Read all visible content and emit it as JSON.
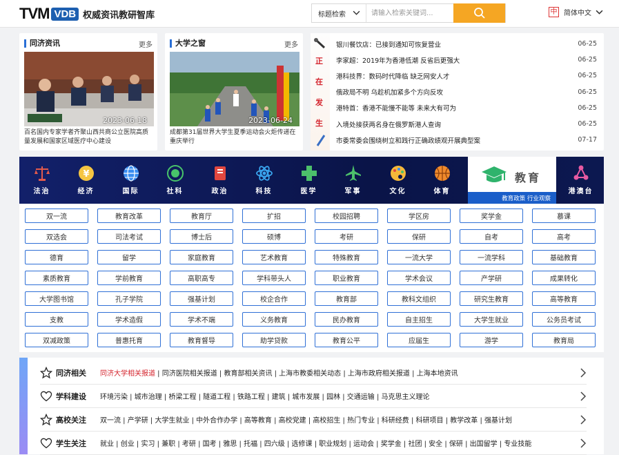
{
  "header": {
    "logo_text": "TVM",
    "logo_badge": "VDB",
    "site_name": "权威资讯教研智库",
    "search_select": "标题检索",
    "search_placeholder": "请输入检索关键词...",
    "lang_icon": "中",
    "lang_label": "简体中文"
  },
  "news_cards": [
    {
      "title": "同济资讯",
      "more": "更多",
      "date": "2023-06-18",
      "caption": "百名国内专家学者齐聚山西共商公立医院高质量发展和国家区域医疗中心建设"
    },
    {
      "title": "大学之窗",
      "more": "更多",
      "date": "2023-06-24",
      "caption": "成都第31届世界大学生夏季运动会火炬传递在重庆举行"
    }
  ],
  "hot": {
    "strip_chars": [
      "正",
      "在",
      "发",
      "生"
    ],
    "items": [
      {
        "text": "银川餐饮店：已接到通知可恢复营业",
        "date": "06-25"
      },
      {
        "text": "李家超：2019年为香港低潮 反省后更强大",
        "date": "06-25"
      },
      {
        "text": "港科技界：数码时代降临 缺乏网安人才",
        "date": "06-25"
      },
      {
        "text": "俄政局不明 乌趁机加紧多个方向反攻",
        "date": "06-25"
      },
      {
        "text": "港特首：香港不能慢不能等 未来大有可为",
        "date": "06-25"
      },
      {
        "text": "入境处接获两名身在俄罗斯港人查询",
        "date": "06-25"
      },
      {
        "text": "市委常委会围绕树立和践行正确政绩观开展典型案",
        "date": "07-17"
      }
    ]
  },
  "categories": [
    {
      "label": "法治",
      "icon": "scale-icon"
    },
    {
      "label": "经济",
      "icon": "coin-icon"
    },
    {
      "label": "国际",
      "icon": "globe-icon"
    },
    {
      "label": "社科",
      "icon": "orbit-icon"
    },
    {
      "label": "政治",
      "icon": "book-icon"
    },
    {
      "label": "科技",
      "icon": "atom-icon"
    },
    {
      "label": "医学",
      "icon": "medical-cross-icon"
    },
    {
      "label": "军事",
      "icon": "jet-icon"
    },
    {
      "label": "文化",
      "icon": "palette-icon"
    },
    {
      "label": "体育",
      "icon": "basketball-icon"
    },
    {
      "label": "港澳台",
      "icon": "network-icon"
    }
  ],
  "active_category": {
    "label": "教育",
    "sub": "教育政策 行业观察",
    "icon": "graduation-cap-icon"
  },
  "tags": [
    [
      "双一流",
      "教育改革",
      "教育厅",
      "扩招",
      "校园招聘",
      "学区房",
      "奖学金",
      "慕课"
    ],
    [
      "双选会",
      "司法考试",
      "博士后",
      "硕博",
      "考研",
      "保研",
      "自考",
      "高考"
    ],
    [
      "德育",
      "留学",
      "家庭教育",
      "艺术教育",
      "特殊教育",
      "一流大学",
      "一流学科",
      "基础教育"
    ],
    [
      "素质教育",
      "学前教育",
      "高职高专",
      "学科带头人",
      "职业教育",
      "学术会议",
      "产学研",
      "成果转化"
    ],
    [
      "大学图书馆",
      "孔子学院",
      "强基计划",
      "校企合作",
      "教育部",
      "教科文组织",
      "研究生教育",
      "高等教育"
    ],
    [
      "支教",
      "学术造假",
      "学术不端",
      "义务教育",
      "民办教育",
      "自主招生",
      "大学生就业",
      "公务员考试"
    ],
    [
      "双减政策",
      "普惠托育",
      "教育督导",
      "助学贷款",
      "教育公平",
      "应届生",
      "游学",
      "教育局"
    ]
  ],
  "topics": [
    {
      "title": "同济相关",
      "icon": "star-icon",
      "highlight": "同济大学相关报道",
      "links": " | 同济医院相关报道 | 教育部相关资讯 | 上海市教委相关动态 | 上海市政府相关报道 | 上海本地资讯"
    },
    {
      "title": "学科建设",
      "icon": "heart-icon",
      "highlight": "",
      "links": "环境污染 | 城市治理 | 桥梁工程 | 隧道工程 | 铁路工程 | 建筑 | 城市发展 | 园林 | 交通运输 | 马克思主义理论"
    },
    {
      "title": "高校关注",
      "icon": "star-icon",
      "highlight": "",
      "links": "双一流 | 产学研 | 大学生就业 | 中外合作办学 | 高等教育 | 高校党建 | 高校招生 | 热门专业 | 科研经费 | 科研项目 | 教学改革 | 强基计划"
    },
    {
      "title": "学生关注",
      "icon": "heart-icon",
      "highlight": "",
      "links": "就业 | 创业 | 实习 | 兼职 | 考研 | 国考 | 雅思 | 托福 | 四六级 | 选修课 | 职业规划 | 运动会 | 奖学金 | 社团 | 安全 | 保研 | 出国留学 | 专业技能"
    }
  ]
}
